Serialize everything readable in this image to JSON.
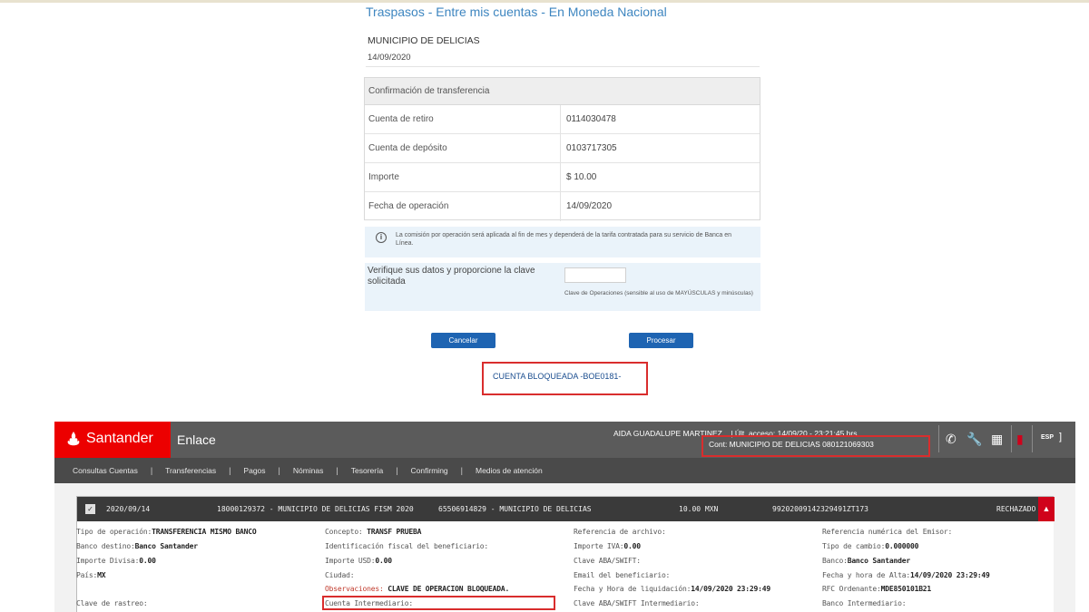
{
  "transfer": {
    "page_title": "Traspasos - Entre mis cuentas - En Moneda Nacional",
    "account_name": "MUNICIPIO DE DELICIAS",
    "date": "14/09/2020",
    "confirm_header": "Confirmación de transferencia",
    "rows": [
      {
        "label": "Cuenta de retiro",
        "value": "0114030478"
      },
      {
        "label": "Cuenta de depósito",
        "value": "0103717305"
      },
      {
        "label": "Importe",
        "value": "$ 10.00"
      },
      {
        "label": "Fecha de operación",
        "value": "14/09/2020"
      }
    ],
    "notice": "La comisión por operación será aplicada al fin de mes y dependerá de la tarifa contratada para su servicio de Banca en Línea.",
    "verify_label": "Verifique sus datos y proporcione la clave solicitada",
    "verify_input_value": "",
    "verify_hint": "Clave de Operaciones (sensible al uso de MAYÚSCULAS y minúsculas)",
    "cancel_label": "Cancelar",
    "process_label": "Procesar",
    "blocked_message": "CUENTA BLOQUEADA -BOE0181-"
  },
  "enlace": {
    "brand": "Santander",
    "app_name": "Enlace",
    "user_line": "AIDA GUADALUPE MARTINEZ...  | Últ. acceso: 14/09/20 - 23:21:45 hrs",
    "contract_line": "Cont: MUNICIPIO DE DELICIAS 080121069303",
    "language": "ESP",
    "icons": [
      "phone-icon",
      "wrench-icon",
      "grid-icon",
      "notification-icon"
    ],
    "nav": [
      "Consultas Cuentas",
      "Transferencias",
      "Pagos",
      "Nóminas",
      "Tesorería",
      "Confirming",
      "Medios de atención"
    ],
    "result": {
      "date": "2020/09/14",
      "origin": "18000129372 - MUNICIPIO DE DELICIAS FISM 2020",
      "destination": "65506914829 - MUNICIPIO DE DELICIAS",
      "amount": "10.00 MXN",
      "reference": "99202009142329491ZT173",
      "status": "RECHAZADO"
    },
    "details": [
      {
        "label": "Tipo de operación:",
        "value": "TRANSFERENCIA MISMO BANCO"
      },
      {
        "label": "Banco destino:",
        "value": "Banco Santander"
      },
      {
        "label": "Importe Divisa:",
        "value": "0.00"
      },
      {
        "label": "País:",
        "value": "MX"
      },
      {
        "label": "Clave de rastreo:",
        "value": ""
      },
      {
        "label": "Concepto: ",
        "value": "TRANSF PRUEBA"
      },
      {
        "label": "Identificación fiscal del beneficiario:",
        "value": ""
      },
      {
        "label": "Importe USD:",
        "value": "0.00"
      },
      {
        "label": "Ciudad:",
        "value": ""
      },
      {
        "label": "Observaciones: ",
        "value": "CLAVE DE OPERACION BLOQUEADA."
      },
      {
        "label": "Cuenta Intermediario:",
        "value": ""
      },
      {
        "label": "Referencia de archivo:",
        "value": ""
      },
      {
        "label": "Importe IVA:",
        "value": "0.00"
      },
      {
        "label": "Clave ABA/SWIFT:",
        "value": ""
      },
      {
        "label": "Email del beneficiario:",
        "value": ""
      },
      {
        "label": "Fecha y Hora de liquidación:",
        "value": "14/09/2020 23:29:49"
      },
      {
        "label": "Clave ABA/SWIFT Intermediario:",
        "value": ""
      },
      {
        "label": "Referencia numérica del Emisor:",
        "value": ""
      },
      {
        "label": "Tipo de cambio:",
        "value": "0.000000"
      },
      {
        "label": "Banco:",
        "value": "Banco Santander"
      },
      {
        "label": "Fecha y hora de Alta:",
        "value": "14/09/2020 23:29:49"
      },
      {
        "label": "RFC Ordenante:",
        "value": "MDE850101B21"
      },
      {
        "label": "Banco Intermediario:",
        "value": ""
      }
    ],
    "colors": {
      "brand_red": "#ec0000",
      "link_blue": "#3e86c0",
      "button_blue": "#1e64b2",
      "highlight_red": "#d92d2d"
    }
  }
}
